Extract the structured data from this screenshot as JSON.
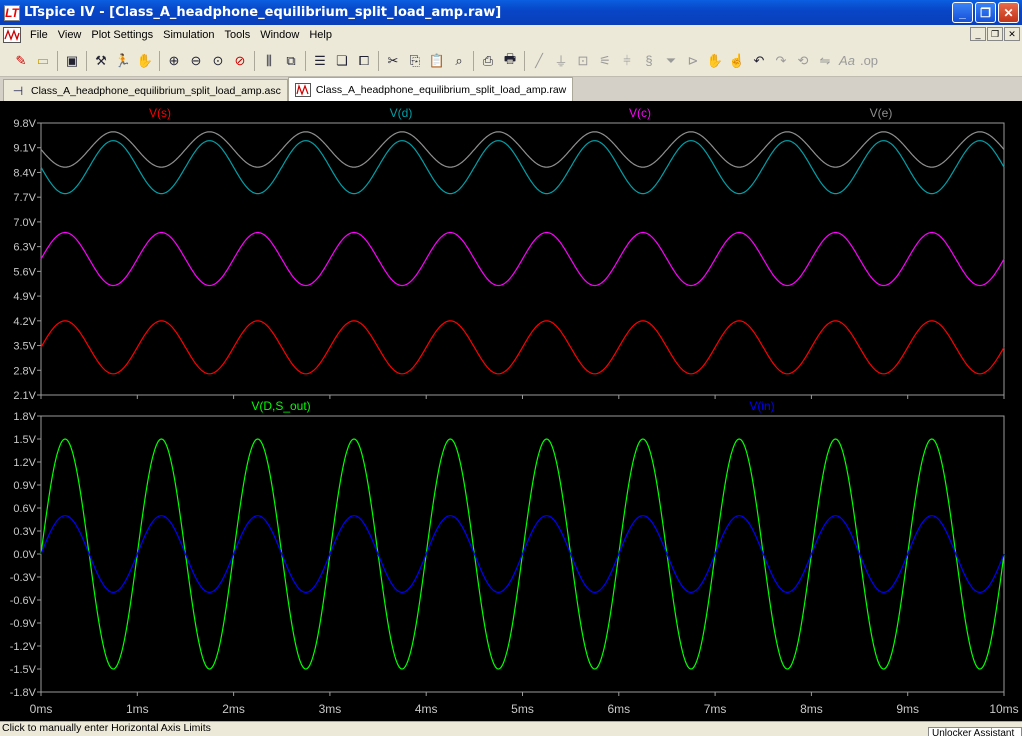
{
  "window": {
    "title": "LTspice IV - [Class_A_headphone_equilibrium_split_load_amp.raw]",
    "app_icon_glyph": "LT",
    "buttons": {
      "minimize": "_",
      "restore": "❐",
      "close": "✕"
    }
  },
  "menu": {
    "items": [
      "File",
      "View",
      "Plot Settings",
      "Simulation",
      "Tools",
      "Window",
      "Help"
    ],
    "mdi": {
      "minimize": "_",
      "restore": "❐",
      "close": "✕"
    }
  },
  "toolbar": {
    "icons": [
      "new-schematic-icon",
      "open-icon",
      "save-icon",
      "control-panel-icon",
      "run-icon",
      "halt-icon",
      "zoom-in-icon",
      "zoom-out-icon",
      "zoom-fit-icon",
      "zoom-cancel-icon",
      "autorange-icon",
      "pick-visible-traces-icon",
      "tile-horizontal-icon",
      "cascade-icon",
      "close-window-icon",
      "cut-icon",
      "copy-icon",
      "paste-icon",
      "find-icon",
      "print-preview-icon",
      "print-icon",
      "wire-icon",
      "ground-icon",
      "label-icon",
      "resistor-icon",
      "capacitor-icon",
      "inductor-icon",
      "diode-icon",
      "component-icon",
      "move-icon",
      "drag-icon",
      "undo-icon",
      "redo-icon",
      "rotate-icon",
      "mirror-icon",
      "text-icon",
      "spice-directive-icon"
    ]
  },
  "tabs": [
    {
      "label": "Class_A_headphone_equilibrium_split_load_amp.asc",
      "icon": "schematic-icon",
      "active": false
    },
    {
      "label": "Class_A_headphone_equilibrium_split_load_amp.raw",
      "icon": "waveform-icon",
      "active": true
    }
  ],
  "status": {
    "text": "Click to manually enter Horizontal Axis Limits",
    "right_text": "Unlocker Assistant"
  },
  "chart_data": [
    {
      "type": "line",
      "x_unit": "ms",
      "xlim": [
        0,
        10
      ],
      "ylim": [
        2.1,
        9.8
      ],
      "yticks": [
        "9.8V",
        "9.1V",
        "8.4V",
        "7.7V",
        "7.0V",
        "6.3V",
        "5.6V",
        "4.9V",
        "4.2V",
        "3.5V",
        "2.8V",
        "2.1V"
      ],
      "grid": false,
      "frequency_khz": 1,
      "series": [
        {
          "name": "V(s)",
          "color": "#ff0000",
          "center": 3.45,
          "amplitude": 0.75,
          "phase": "sin"
        },
        {
          "name": "V(d)",
          "color": "#00a0a8",
          "center": 8.55,
          "amplitude": 0.75,
          "phase": "-sin"
        },
        {
          "name": "V(c)",
          "color": "#ff00ff",
          "center": 5.95,
          "amplitude": 0.75,
          "phase": "sin"
        },
        {
          "name": "V(e)",
          "color": "#909090",
          "center": 9.05,
          "amplitude": 0.5,
          "phase": "-sin"
        }
      ]
    },
    {
      "type": "line",
      "x_unit": "ms",
      "xlim": [
        0,
        10
      ],
      "ylim": [
        -1.8,
        1.8
      ],
      "yticks": [
        "1.8V",
        "1.5V",
        "1.2V",
        "0.9V",
        "0.6V",
        "0.3V",
        "0.0V",
        "-0.3V",
        "-0.6V",
        "-0.9V",
        "-1.2V",
        "-1.5V",
        "-1.8V"
      ],
      "xticks": [
        "0ms",
        "1ms",
        "2ms",
        "3ms",
        "4ms",
        "5ms",
        "6ms",
        "7ms",
        "8ms",
        "9ms",
        "10ms"
      ],
      "grid": false,
      "frequency_khz": 1,
      "series": [
        {
          "name": "V(D,S_out)",
          "color": "#00ff00",
          "center": 0,
          "amplitude": 1.5,
          "phase": "sin"
        },
        {
          "name": "V(in)",
          "color": "#0000ff",
          "center": 0,
          "amplitude": 0.5,
          "phase": "sin"
        }
      ]
    }
  ]
}
